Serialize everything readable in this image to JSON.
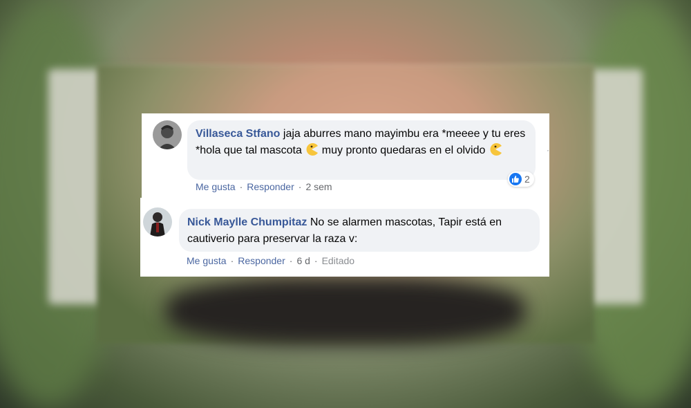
{
  "comments": [
    {
      "author": "Villaseca Stfano",
      "text_part1": " jaja aburres mano mayimbu era *meeee y tu eres *hola que tal mascota ",
      "text_part2": " muy pronto quedaras en el olvido ",
      "emoji": "pacman-emoji",
      "actions": {
        "like": "Me gusta",
        "reply": "Responder",
        "time": "2 sem"
      },
      "reaction_count": "2",
      "reaction_icon": "like-icon"
    },
    {
      "author": "Nick Maylle Chumpitaz",
      "text": " No se alarmen mascotas, Tapir está en cautiverio para preservar la raza v:",
      "actions": {
        "like": "Me gusta",
        "reply": "Responder",
        "time": "6 d",
        "edited": "Editado"
      }
    }
  ],
  "separator": "·",
  "colors": {
    "author": "#385898",
    "bubble": "#f0f2f5",
    "link": "#4b67a1",
    "like_blue": "#1877f2"
  }
}
